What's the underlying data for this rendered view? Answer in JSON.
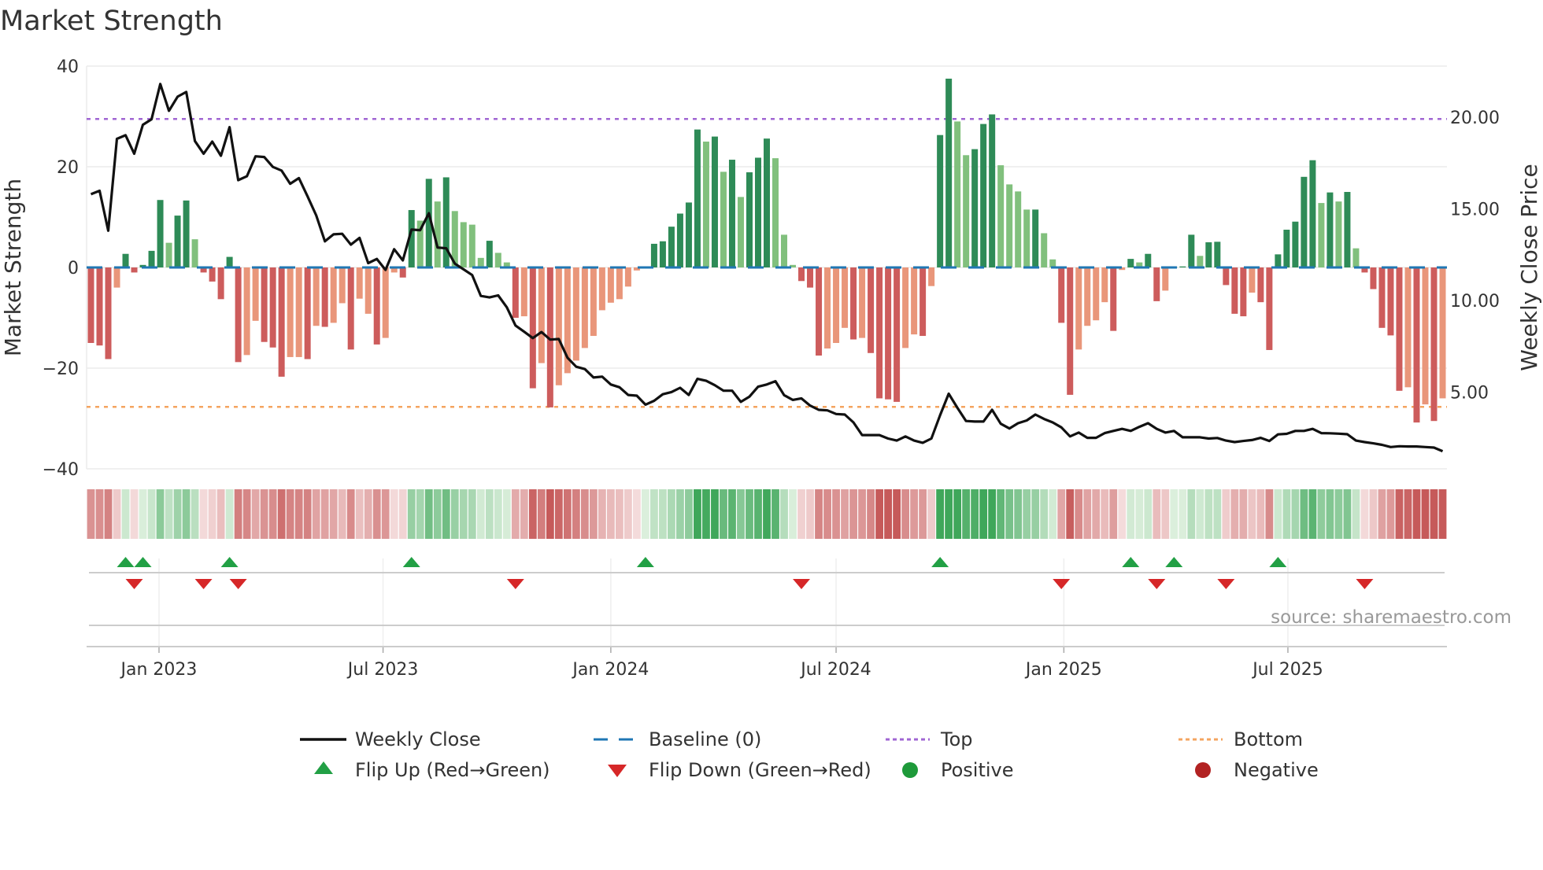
{
  "title": "Market Strength",
  "source": "source: sharemaestro.com",
  "colors": {
    "bar_pos_strong": "#2e8b57",
    "bar_pos_weak": "#81c07d",
    "bar_neg_strong": "#cd5c5c",
    "bar_neg_weak": "#e9967a",
    "close_line": "#111111",
    "baseline": "#1f77b4",
    "top": "#a066d3",
    "bottom": "#f4a460",
    "flip_up": "#22a045",
    "flip_down": "#d62728",
    "positive": "#1e9a3a",
    "negative": "#b22222"
  },
  "chart_data": {
    "type": "bar+line",
    "x_start": "2022-11-07",
    "x_step_days": 7,
    "strength": [
      -15,
      -15.5,
      -18.2,
      -4,
      2.7,
      -1,
      0.5,
      3.3,
      13.4,
      4.9,
      10.3,
      13.3,
      5.6,
      -1,
      -2.8,
      -6.3,
      2.1,
      -18.8,
      -17.4,
      -10.6,
      -14.8,
      -15.9,
      -21.7,
      -17.8,
      -17.8,
      -18.2,
      -11.6,
      -11.8,
      -11,
      -7.1,
      -16.3,
      -6.2,
      -9.2,
      -15.3,
      -14,
      -1,
      -2,
      11.4,
      9.3,
      17.6,
      13.1,
      17.9,
      11.2,
      9,
      8.5,
      1.9,
      5.3,
      2.9,
      1,
      -10,
      -9.7,
      -24,
      -19,
      -27.8,
      -23.4,
      -21,
      -18.5,
      -16,
      -13.6,
      -8.5,
      -7,
      -6.3,
      -3.8,
      -0.6,
      0.1,
      4.7,
      5.2,
      8.1,
      10.7,
      12.9,
      27.4,
      25,
      26,
      19,
      21.4,
      14,
      18.9,
      21.8,
      25.6,
      21.7,
      6.5,
      0.5,
      -2.7,
      -4,
      -17.5,
      -16.1,
      -15,
      -12,
      -14.3,
      -14,
      -17,
      -26,
      -26.2,
      -26.7,
      -16,
      -13.3,
      -13.6,
      -3.7,
      26.3,
      37.5,
      29,
      22.3,
      23.5,
      28.5,
      30.4,
      20.3,
      16.5,
      15.1,
      11.5,
      11.5,
      6.8,
      1.6,
      -11,
      -25.3,
      -16.3,
      -11.6,
      -10.5,
      -6.9,
      -12.6,
      -0.5,
      1.7,
      1,
      2.7,
      -6.7,
      -4.6,
      0.1,
      0.2,
      6.5,
      2.3,
      5,
      5.1,
      -3.5,
      -9.2,
      -9.7,
      -5,
      -6.9,
      -16.4,
      2.6,
      7.5,
      9.1,
      18,
      21.3,
      12.8,
      14.9,
      13.1,
      15,
      3.8,
      -1,
      -4.3,
      -12,
      -13.5,
      -24.5,
      -23.8,
      -30.8,
      -27.2,
      -30.5,
      -26
    ],
    "shade": [
      "d",
      "d",
      "d",
      "l",
      "d",
      "d",
      "d",
      "d",
      "d",
      "l",
      "d",
      "d",
      "l",
      "d",
      "d",
      "d",
      "d",
      "d",
      "l",
      "l",
      "d",
      "d",
      "d",
      "l",
      "l",
      "d",
      "l",
      "d",
      "l",
      "l",
      "d",
      "l",
      "l",
      "d",
      "l",
      "l",
      "d",
      "d",
      "l",
      "d",
      "l",
      "d",
      "l",
      "l",
      "l",
      "l",
      "d",
      "l",
      "l",
      "d",
      "l",
      "d",
      "l",
      "d",
      "l",
      "l",
      "l",
      "l",
      "l",
      "l",
      "l",
      "l",
      "l",
      "l",
      "d",
      "d",
      "d",
      "d",
      "d",
      "d",
      "d",
      "l",
      "d",
      "l",
      "d",
      "l",
      "d",
      "d",
      "d",
      "l",
      "l",
      "l",
      "d",
      "d",
      "d",
      "l",
      "l",
      "l",
      "d",
      "l",
      "d",
      "d",
      "d",
      "d",
      "l",
      "l",
      "d",
      "l",
      "d",
      "d",
      "l",
      "l",
      "d",
      "d",
      "d",
      "l",
      "l",
      "l",
      "l",
      "d",
      "l",
      "l",
      "d",
      "d",
      "l",
      "l",
      "l",
      "l",
      "d",
      "l",
      "d",
      "l",
      "d",
      "d",
      "l",
      "d",
      "d",
      "d",
      "l",
      "d",
      "d",
      "d",
      "d",
      "d",
      "l",
      "d",
      "d",
      "d",
      "d",
      "d",
      "d",
      "d",
      "l",
      "d",
      "l",
      "d",
      "l",
      "d",
      "d",
      "d",
      "d",
      "d",
      "l",
      "d",
      "l",
      "d",
      "l"
    ],
    "close": [
      15.8,
      15.99,
      13.81,
      18.82,
      19.02,
      18.01,
      19.59,
      19.89,
      21.81,
      20.35,
      21.12,
      21.38,
      18.7,
      18.01,
      18.67,
      17.9,
      19.46,
      16.57,
      16.78,
      17.87,
      17.83,
      17.29,
      17.09,
      16.37,
      16.68,
      15.68,
      14.64,
      13.23,
      13.61,
      13.64,
      13.05,
      13.42,
      12.04,
      12.27,
      11.67,
      12.8,
      12.19,
      13.87,
      13.84,
      14.76,
      12.89,
      12.85,
      12.01,
      11.7,
      11.39,
      10.25,
      10.17,
      10.28,
      9.63,
      8.64,
      8.3,
      7.95,
      8.28,
      7.87,
      7.9,
      6.88,
      6.39,
      6.26,
      5.8,
      5.85,
      5.42,
      5.27,
      4.85,
      4.81,
      4.32,
      4.53,
      4.89,
      5.01,
      5.24,
      4.85,
      5.73,
      5.62,
      5.38,
      5.08,
      5.08,
      4.47,
      4.76,
      5.3,
      5.42,
      5.6,
      4.84,
      4.58,
      4.66,
      4.27,
      4.04,
      4.01,
      3.81,
      3.78,
      3.35,
      2.66,
      2.66,
      2.66,
      2.47,
      2.36,
      2.59,
      2.36,
      2.24,
      2.47,
      3.74,
      4.92,
      4.15,
      3.43,
      3.4,
      3.4,
      4.04,
      3.28,
      3.02,
      3.31,
      3.46,
      3.78,
      3.54,
      3.35,
      3.08,
      2.59,
      2.8,
      2.51,
      2.51,
      2.77,
      2.89,
      3.0,
      2.89,
      3.11,
      3.31,
      3.0,
      2.8,
      2.89,
      2.54,
      2.54,
      2.54,
      2.47,
      2.5,
      2.36,
      2.28,
      2.34,
      2.39,
      2.51,
      2.34,
      2.7,
      2.73,
      2.89,
      2.89,
      3.0,
      2.77,
      2.76,
      2.74,
      2.71,
      2.36,
      2.28,
      2.21,
      2.13,
      2.01,
      2.05,
      2.04,
      2.04,
      2.01,
      1.98,
      1.78
    ],
    "y_left": {
      "label": "Market Strength",
      "range": [
        -40,
        40
      ],
      "ticks": [
        {
          "value": 40,
          "label": "40"
        },
        {
          "value": 20,
          "label": "20"
        },
        {
          "value": 0,
          "label": "0"
        },
        {
          "value": -20,
          "label": "−20"
        },
        {
          "value": -40,
          "label": "−40"
        }
      ]
    },
    "y_right": {
      "label": "Weekly Close Price",
      "range": [
        0.82,
        22.79
      ],
      "ticks": [
        {
          "value": 20,
          "label": "20.00"
        },
        {
          "value": 15,
          "label": "15.00"
        },
        {
          "value": 10,
          "label": "10.00"
        },
        {
          "value": 5,
          "label": "5.00"
        }
      ]
    },
    "top": 29.5,
    "bottom": -27.7,
    "baseline": 0,
    "x_ticks": [
      {
        "date": "2023-01-01",
        "label": "Jan 2023"
      },
      {
        "date": "2023-07-01",
        "label": "Jul 2023"
      },
      {
        "date": "2024-01-01",
        "label": "Jan 2024"
      },
      {
        "date": "2024-07-01",
        "label": "Jul 2024"
      },
      {
        "date": "2025-01-01",
        "label": "Jan 2025"
      },
      {
        "date": "2025-07-01",
        "label": "Jul 2025"
      }
    ],
    "flip_up": [
      "2022-12-05",
      "2022-12-19",
      "2023-02-27",
      "2023-07-24",
      "2024-01-29",
      "2024-09-23",
      "2025-02-24",
      "2025-03-31",
      "2025-06-23"
    ],
    "flip_down": [
      "2022-12-12",
      "2023-02-06",
      "2023-03-06",
      "2023-10-16",
      "2024-06-03",
      "2024-12-30",
      "2025-03-17",
      "2025-05-12",
      "2025-09-01"
    ],
    "legend": [
      {
        "label": "Weekly Close",
        "icon": "line"
      },
      {
        "label": "Baseline (0)",
        "icon": "dashed"
      },
      {
        "label": "Top",
        "icon": "dotted-top"
      },
      {
        "label": "Bottom",
        "icon": "dotted-bottom"
      },
      {
        "label": "Flip Up (Red→Green)",
        "icon": "triangle-up"
      },
      {
        "label": "Flip Down (Green→Red)",
        "icon": "triangle-down"
      },
      {
        "label": "Positive",
        "icon": "circle-positive"
      },
      {
        "label": "Negative",
        "icon": "circle-negative"
      }
    ]
  }
}
